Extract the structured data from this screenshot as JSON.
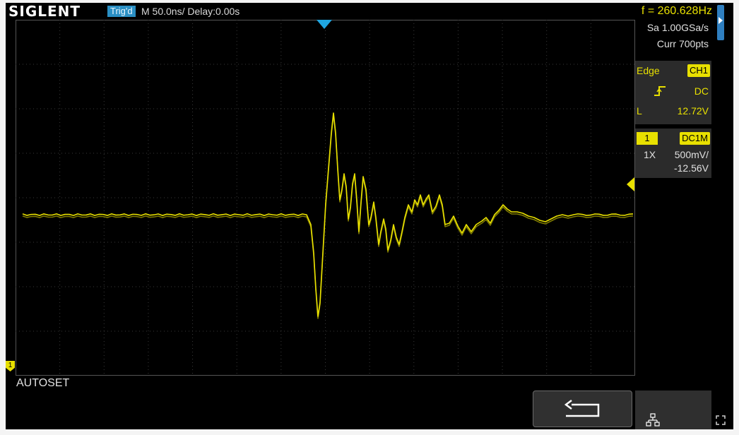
{
  "header": {
    "brand": "SIGLENT",
    "trigger_status": "Trig'd",
    "timebase": "M 50.0ns/",
    "delay": "Delay:0.00s",
    "frequency": "f = 260.628Hz"
  },
  "acquisition": {
    "sample_rate": "Sa 1.00GSa/s",
    "memory_depth": "Curr 700pts"
  },
  "trigger": {
    "type": "Edge",
    "source": "CH1",
    "slope_icon": "rising-edge-icon",
    "coupling": "DC",
    "level_label": "L",
    "level": "12.72V"
  },
  "channel1": {
    "number": "1",
    "coupling": "DC1M",
    "probe": "1X",
    "scale": "500mV/",
    "offset": "-12.56V",
    "marker": "1"
  },
  "footer": {
    "message": "AUTOSET"
  },
  "icons": {
    "back": "back-arrow-icon",
    "network": "network-icon",
    "expand": "expand-icon"
  },
  "colors": {
    "ch1": "#e8e000",
    "trigger_marker": "#1fa6e0",
    "grid": "#3a3a3a"
  }
}
